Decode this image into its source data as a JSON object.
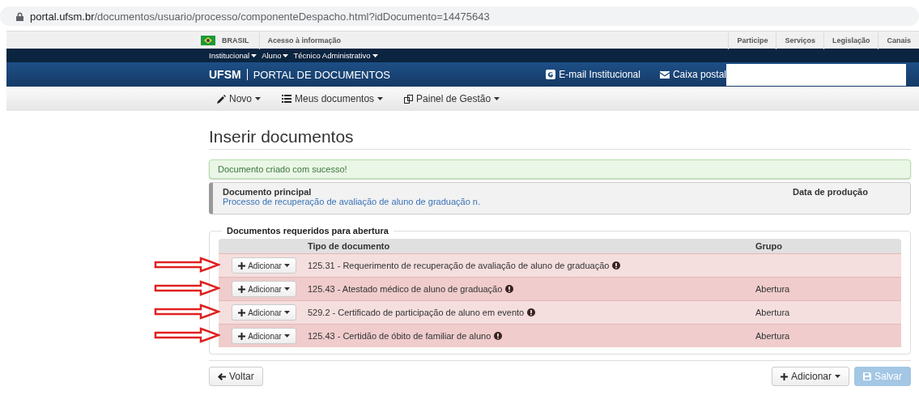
{
  "address_bar": {
    "host": "portal.ufsm.br",
    "path": "/documentos/usuario/processo/componenteDespacho.html?idDocumento=14475643"
  },
  "gov_bar": {
    "country": "BRASIL",
    "access": "Acesso à informação",
    "links": [
      "Participe",
      "Serviços",
      "Legislação",
      "Canais"
    ]
  },
  "nav_menu": [
    "Institucional",
    "Aluno",
    "Técnico Administrativo"
  ],
  "header": {
    "brand": "UFSM",
    "title": "PORTAL DE DOCUMENTOS",
    "email": "E-mail Institucional",
    "mailbox": "Caixa postal"
  },
  "menu": [
    {
      "label": "Novo"
    },
    {
      "label": "Meus documentos"
    },
    {
      "label": "Painel de Gestão"
    }
  ],
  "page_title": "Inserir documentos",
  "alert": "Documento criado com sucesso!",
  "main_document": {
    "label": "Documento principal",
    "link": "Processo de recuperação de avaliação de aluno de graduação n.",
    "date_label": "Data de produção"
  },
  "required": {
    "legend": "Documentos requeridos para abertura",
    "columns": [
      "Tipo de documento",
      "Grupo"
    ],
    "rows": [
      {
        "button": "Adicionar",
        "type": "125.31 - Requerimento de recuperação de avaliação de aluno de graduação"
      },
      {
        "button": "Adicionar",
        "type": "125.43 - Atestado médico de aluno de graduação",
        "group": "Abertura"
      },
      {
        "button": "Adicionar",
        "type": "529.2 - Certificado de participação de aluno em evento",
        "group": "Abertura"
      },
      {
        "button": "Adicionar",
        "type": "125.43 - Certidão de óbito de familiar de aluno",
        "group": "Abertura"
      }
    ]
  },
  "footer": {
    "back": "Voltar",
    "add": "Adicionar",
    "save": {
      "label": "Salvar",
      "disabled": true
    }
  }
}
